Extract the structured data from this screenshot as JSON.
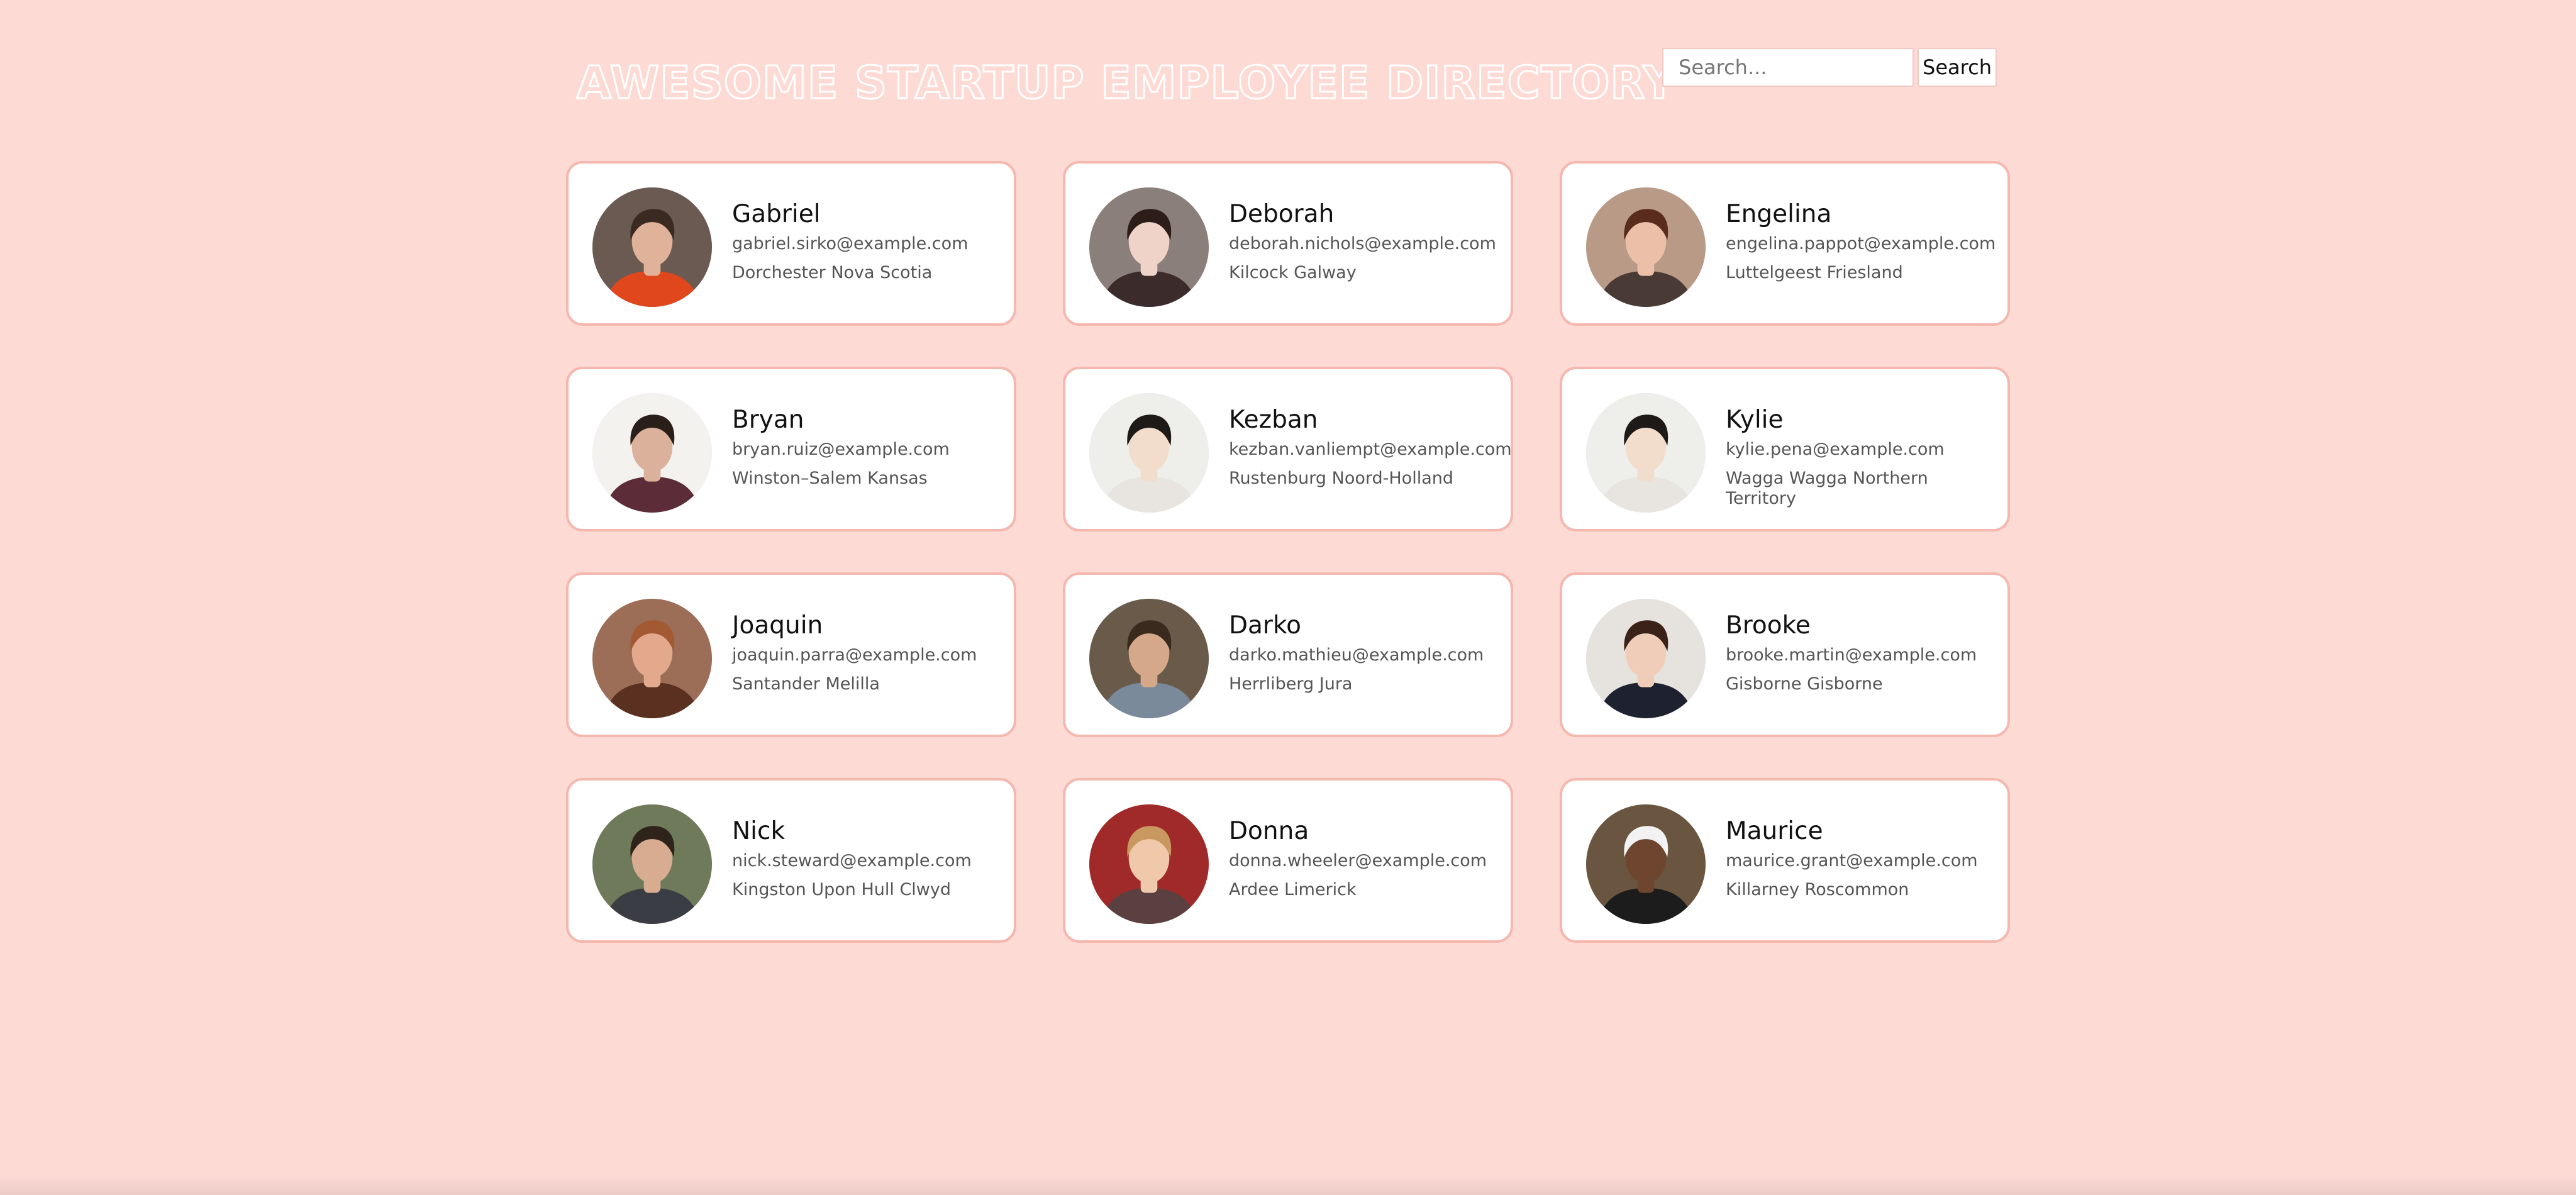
{
  "header": {
    "title": "AWESOME STARTUP EMPLOYEE DIRECTORY"
  },
  "search": {
    "placeholder": "Search...",
    "value": "",
    "button_label": "Search"
  },
  "employees": [
    {
      "name": "Gabriel",
      "email": "gabriel.sirko@example.com",
      "location": "Dorchester Nova Scotia",
      "avatar_icon": "portrait-photo",
      "bg": "#6b5a52",
      "skin": "#e0b29a",
      "hair": "#3a2a22",
      "shirt": "#e1471c"
    },
    {
      "name": "Deborah",
      "email": "deborah.nichols@example.com",
      "location": "Kilcock Galway",
      "avatar_icon": "portrait-photo",
      "bg": "#8a7f7a",
      "skin": "#f0d3c8",
      "hair": "#2d1d18",
      "shirt": "#3b2b2b"
    },
    {
      "name": "Engelina",
      "email": "engelina.pappot@example.com",
      "location": "Luttelgeest Friesland",
      "avatar_icon": "portrait-photo",
      "bg": "#b89a86",
      "skin": "#ecc0a8",
      "hair": "#5a2c1e",
      "shirt": "#4a3a36"
    },
    {
      "name": "Bryan",
      "email": "bryan.ruiz@example.com",
      "location": "Winston–Salem Kansas",
      "avatar_icon": "portrait-photo",
      "bg": "#f4f2ef",
      "skin": "#dbb19c",
      "hair": "#2a1e18",
      "shirt": "#5c2c38"
    },
    {
      "name": "Kezban",
      "email": "kezban.vanliempt@example.com",
      "location": "Rustenburg Noord-Holland",
      "avatar_icon": "portrait-photo",
      "bg": "#eeeeea",
      "skin": "#f2dccc",
      "hair": "#1e1a18",
      "shirt": "#e8e4df"
    },
    {
      "name": "Kylie",
      "email": "kylie.pena@example.com",
      "location": "Wagga Wagga Northern Territory",
      "avatar_icon": "portrait-photo",
      "bg": "#eeeeea",
      "skin": "#f2dccc",
      "hair": "#1e1a18",
      "shirt": "#e8e4df"
    },
    {
      "name": "Joaquin",
      "email": "joaquin.parra@example.com",
      "location": "Santander Melilla",
      "avatar_icon": "portrait-photo",
      "bg": "#9c6e58",
      "skin": "#e2a98c",
      "hair": "#a35a32",
      "shirt": "#5a3020"
    },
    {
      "name": "Darko",
      "email": "darko.mathieu@example.com",
      "location": "Herrliberg Jura",
      "avatar_icon": "portrait-photo",
      "bg": "#6a5a4a",
      "skin": "#d6a88a",
      "hair": "#3a2a1e",
      "shirt": "#7a8a9a"
    },
    {
      "name": "Brooke",
      "email": "brooke.martin@example.com",
      "location": "Gisborne Gisborne",
      "avatar_icon": "portrait-photo",
      "bg": "#e6e2de",
      "skin": "#f0cdb8",
      "hair": "#3a2218",
      "shirt": "#1e2230"
    },
    {
      "name": "Nick",
      "email": "nick.steward@example.com",
      "location": "Kingston Upon Hull Clwyd",
      "avatar_icon": "portrait-photo",
      "bg": "#6f7a5a",
      "skin": "#d8ac90",
      "hair": "#2e241c",
      "shirt": "#3a3e44"
    },
    {
      "name": "Donna",
      "email": "donna.wheeler@example.com",
      "location": "Ardee Limerick",
      "avatar_icon": "portrait-photo",
      "bg": "#a02a2a",
      "skin": "#f0c8aa",
      "hair": "#c89860",
      "shirt": "#5a4040"
    },
    {
      "name": "Maurice",
      "email": "maurice.grant@example.com",
      "location": "Killarney Roscommon",
      "avatar_icon": "portrait-photo",
      "bg": "#6a5640",
      "skin": "#6e4630",
      "hair": "#f2f2f2",
      "shirt": "#1c1c1c"
    }
  ],
  "colors": {
    "page_background": "#fedad5",
    "card_border": "#f5b8ae",
    "card_background": "#ffffff"
  }
}
